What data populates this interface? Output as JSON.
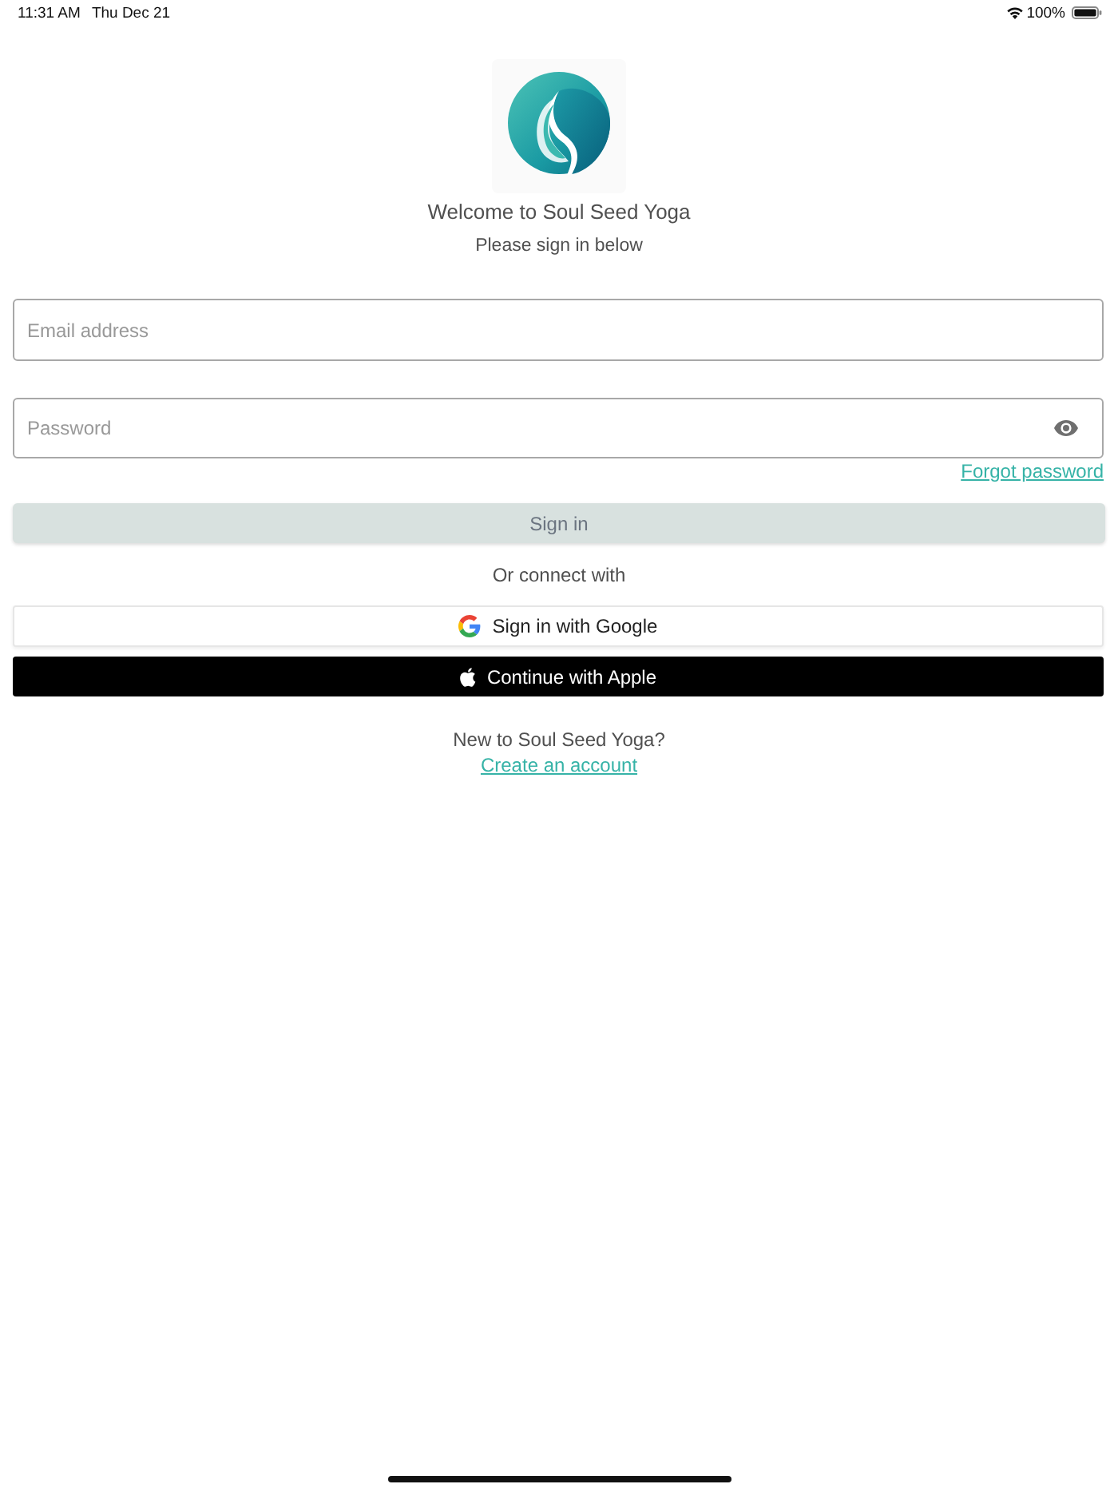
{
  "status_bar": {
    "time": "11:31 AM",
    "date": "Thu Dec 21",
    "battery": "100%"
  },
  "header": {
    "title": "Welcome to Soul Seed Yoga",
    "subtitle": "Please sign in below"
  },
  "form": {
    "email": {
      "placeholder": "Email address"
    },
    "password": {
      "placeholder": "Password"
    },
    "forgot_link": "Forgot password",
    "sign_in_button": {
      "label": "Sign in",
      "disabled": true
    }
  },
  "social": {
    "divider_text": "Or connect with",
    "buttons": [
      {
        "kind": "google",
        "label": "Sign in with Google"
      },
      {
        "kind": "apple",
        "label": "Continue with Apple"
      }
    ]
  },
  "footer": {
    "prompt": "New to Soul Seed Yoga?",
    "link": "Create an account"
  }
}
